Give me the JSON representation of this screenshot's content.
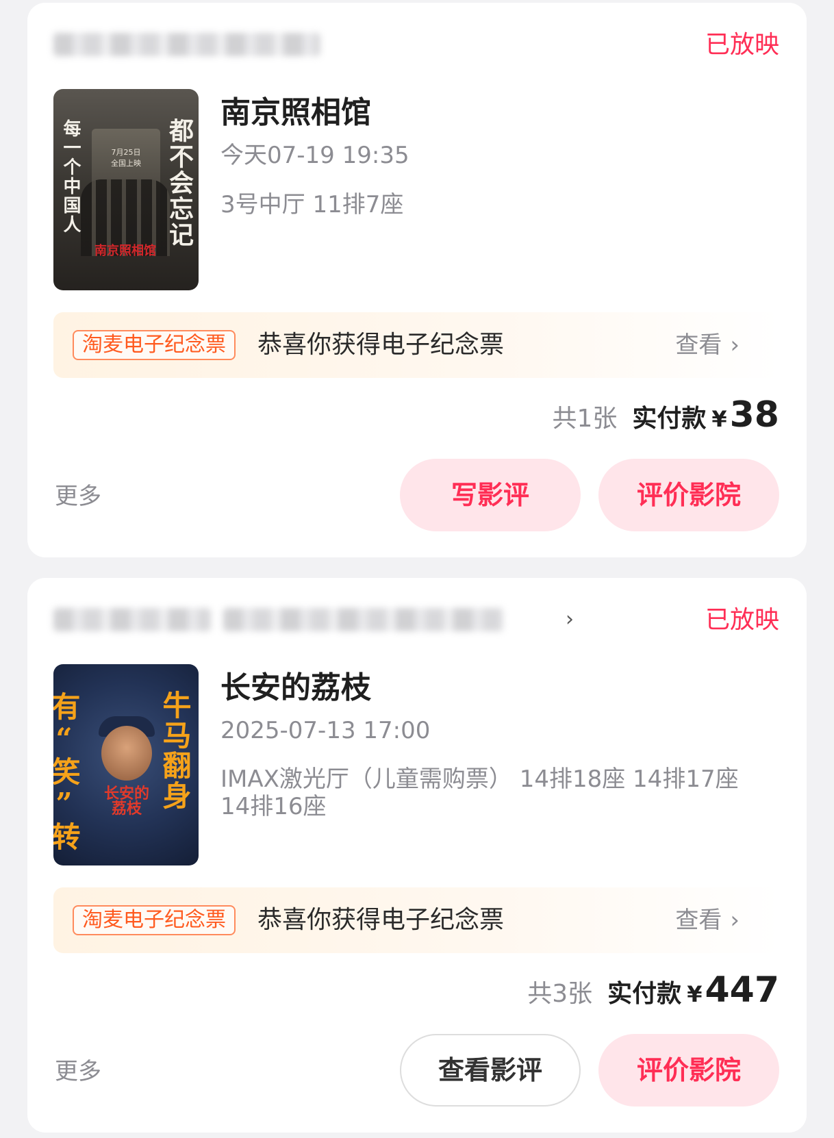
{
  "orders": [
    {
      "cinema_name": "",
      "status": "已放映",
      "movie_title": "南京照相馆",
      "show_time": "今天07-19 19:35",
      "seat_info": "3号中厅 11排7座",
      "poster_text": {
        "left": "每一个中国人",
        "right": "都不会忘记",
        "date": "7月25日",
        "release": "全国上映",
        "title": "南京照相馆"
      },
      "souvenir": {
        "tag": "淘麦电子纪念票",
        "text": "恭喜你获得电子纪念票",
        "link": "查看"
      },
      "ticket_count": "共1张",
      "paid_label": "实付款",
      "currency": "¥",
      "amount": "38",
      "more": "更多",
      "actions": [
        "写影评",
        "评价影院"
      ]
    },
    {
      "cinema_name": "",
      "status": "已放映",
      "movie_title": "长安的荔枝",
      "show_time": "2025-07-13 17:00",
      "seat_info": "IMAX激光厅（儿童需购票） 14排18座 14排17座 14排16座",
      "poster_text": {
        "left": "有“笑”转运",
        "right": "牛马翻身",
        "title": "长安的荔枝"
      },
      "souvenir": {
        "tag": "淘麦电子纪念票",
        "text": "恭喜你获得电子纪念票",
        "link": "查看"
      },
      "ticket_count": "共3张",
      "paid_label": "实付款",
      "currency": "¥",
      "amount": "447",
      "more": "更多",
      "actions": [
        "查看影评",
        "评价影院"
      ]
    }
  ],
  "colors": {
    "accent": "#ff2e55",
    "accent_bg": "#ffe5ea",
    "souvenir_tag": "#ff5a1f",
    "muted_text": "#8c8c92",
    "page_bg": "#f2f2f4"
  },
  "icons": [
    "chevron-right-icon"
  ]
}
